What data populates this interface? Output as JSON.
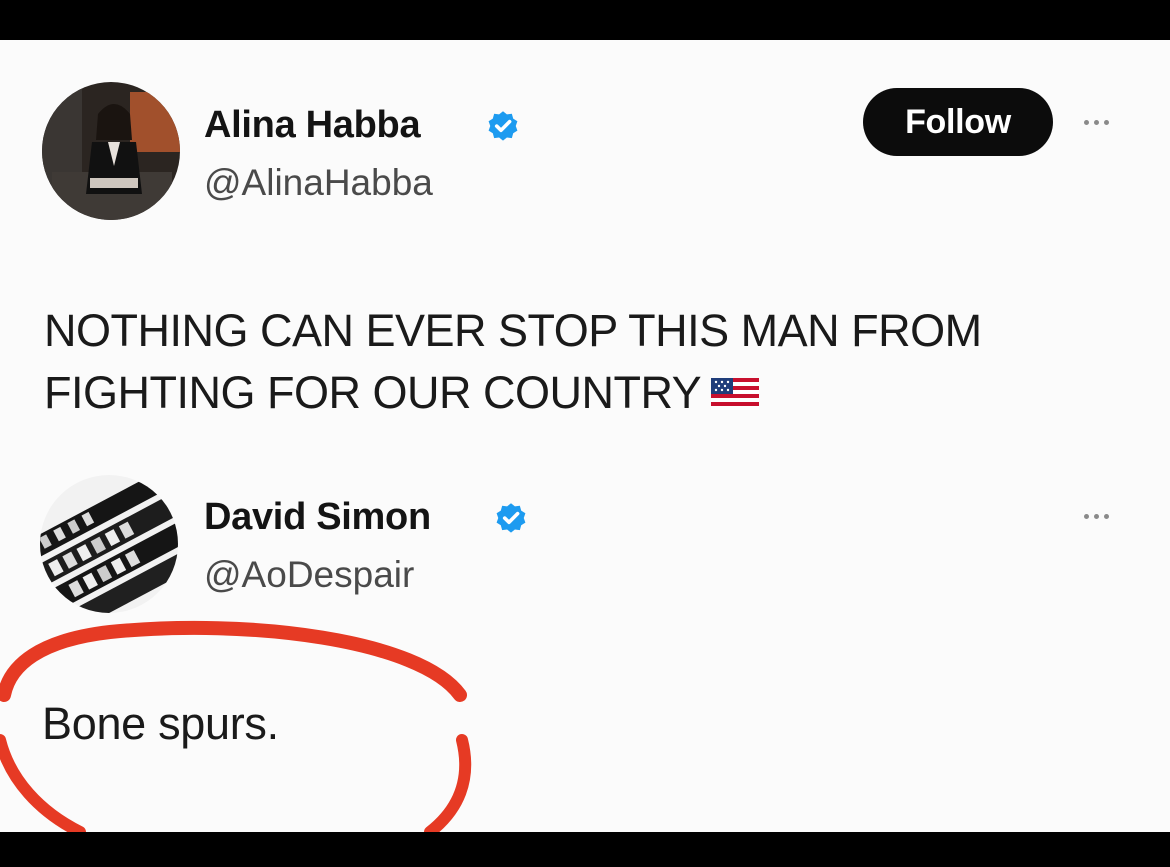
{
  "tweet": {
    "author": {
      "name": "Alina Habba",
      "handle": "@AlinaHabba",
      "verified": true
    },
    "follow_label": "Follow",
    "text_line1": "NOTHING CAN EVER STOP THIS MAN FROM",
    "text_line2": "FIGHTING FOR OUR COUNTRY",
    "emoji": "flag-usa"
  },
  "reply": {
    "author": {
      "name": "David Simon",
      "handle": "@AoDespair",
      "verified": true
    },
    "text": "Bone spurs."
  },
  "colors": {
    "verified_badge": "#1d9bf0",
    "highlight_circle": "#e63a24",
    "follow_button": "#0c0c0c"
  }
}
